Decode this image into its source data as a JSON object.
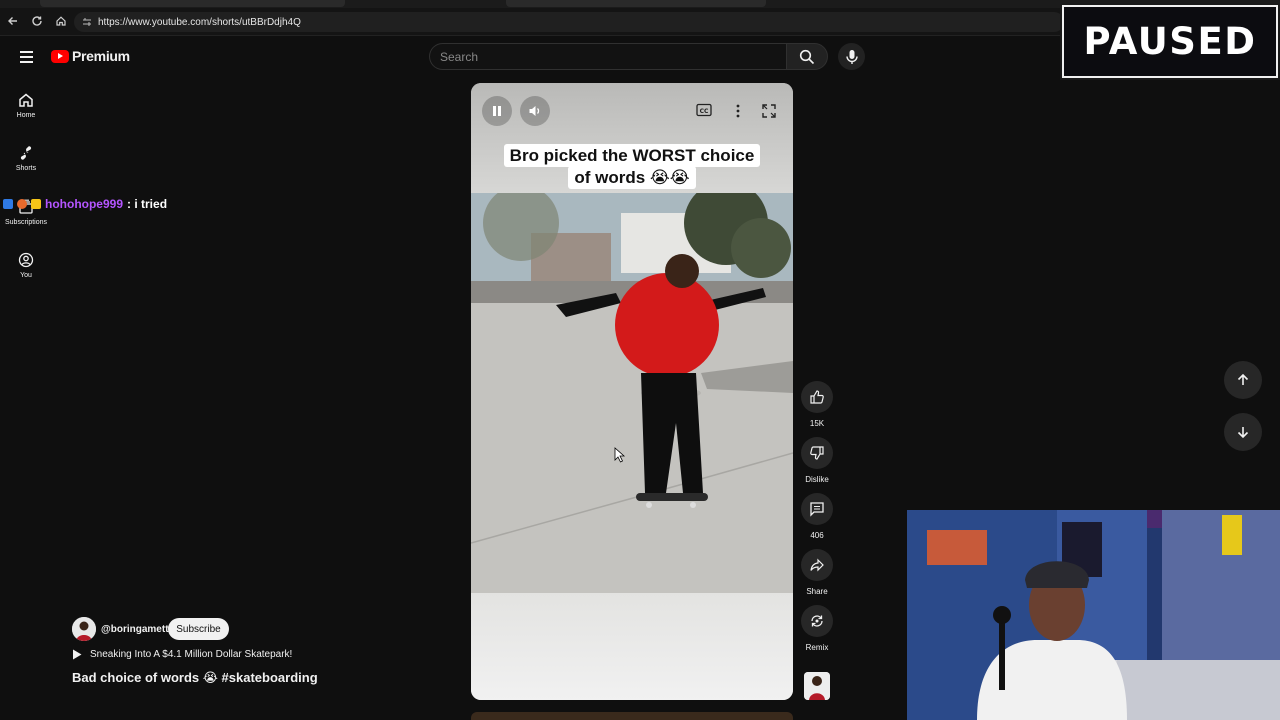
{
  "browser": {
    "url": "https://www.youtube.com/shorts/utBBrDdjh4Q"
  },
  "header": {
    "logo_text": "Premium",
    "search_placeholder": "Search"
  },
  "sidebar": {
    "items": [
      {
        "label": "Home",
        "icon": "home-icon"
      },
      {
        "label": "Shorts",
        "icon": "shorts-icon"
      },
      {
        "label": "Subscriptions",
        "icon": "subscriptions-icon"
      },
      {
        "label": "You",
        "icon": "you-icon"
      }
    ]
  },
  "chat": {
    "username": "hohohope999",
    "message": ": i tried"
  },
  "video": {
    "caption": "Bro picked the WORST choice of words 😭😭"
  },
  "actions": {
    "like_label": "15K",
    "dislike_label": "Dislike",
    "comments_label": "406",
    "share_label": "Share",
    "remix_label": "Remix"
  },
  "meta": {
    "channel_handle": "@boringamett",
    "subscribe_label": "Subscribe",
    "related_title": "Sneaking Into A $4.1 Million Dollar Skatepark!",
    "title": "Bad choice of words 😭 #skateboarding"
  },
  "overlay": {
    "paused_text": "PAUSED"
  },
  "colors": {
    "background": "#0f0f0f",
    "brand_red": "#ff0000",
    "chat_username": "#b455ff"
  }
}
